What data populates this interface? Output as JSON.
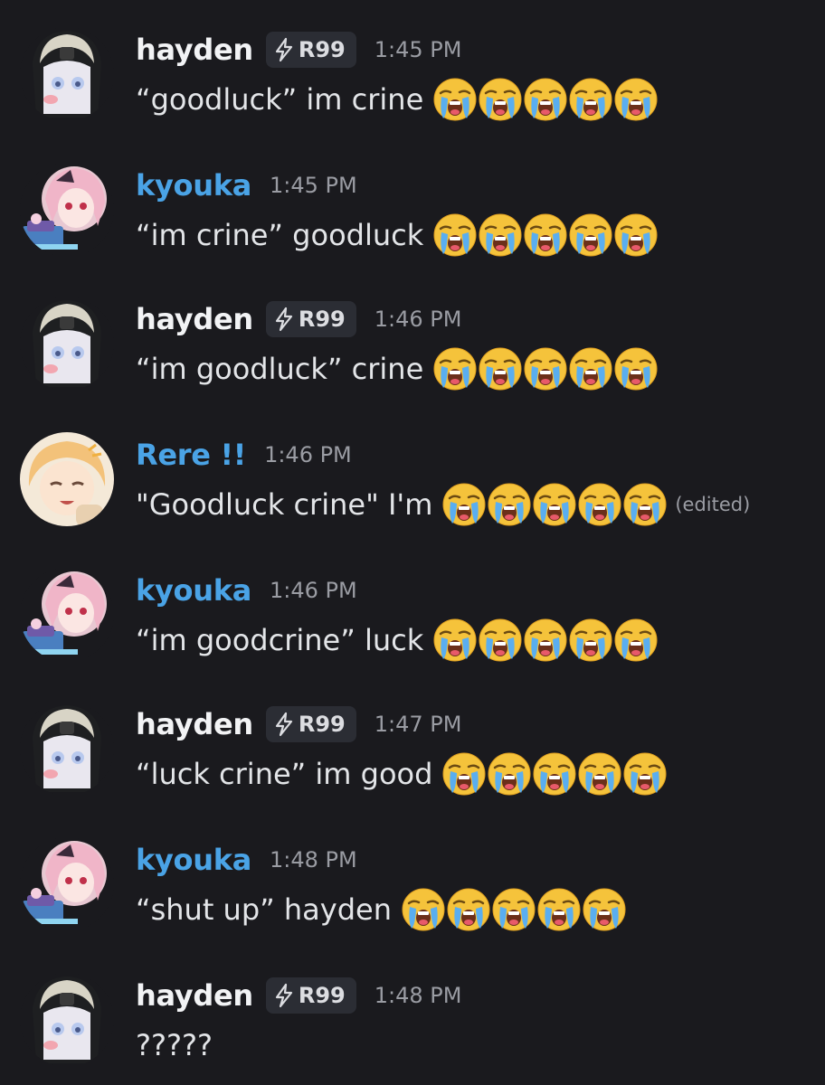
{
  "colors": {
    "background": "#1a1a1e",
    "username_default": "#f2f3f5",
    "username_blue": "#4aa3e6",
    "message_text": "#e3e5e8",
    "timestamp": "#9a9ca3",
    "tag_background": "#2b2d34"
  },
  "messages": [
    {
      "author": "hayden",
      "avatar": "hayden-avatar",
      "tag": "R99",
      "tag_icon": "lightning-bolt-icon",
      "time": "1:45 PM",
      "text": "“goodluck” im crine",
      "emoji": "loudly-crying-face-emoji",
      "emoji_count": 5
    },
    {
      "author": "kyouka",
      "avatar": "kyouka-avatar",
      "time": "1:45 PM",
      "text": "“im crine” goodluck",
      "emoji": "loudly-crying-face-emoji",
      "emoji_count": 5
    },
    {
      "author": "hayden",
      "avatar": "hayden-avatar",
      "tag": "R99",
      "tag_icon": "lightning-bolt-icon",
      "time": "1:46 PM",
      "text": "“im goodluck” crine",
      "emoji": "loudly-crying-face-emoji",
      "emoji_count": 5
    },
    {
      "author": "Rere !!",
      "avatar": "rere-avatar",
      "time": "1:46 PM",
      "text": "\"Goodluck crine\" I'm",
      "emoji": "loudly-crying-face-emoji",
      "emoji_count": 5,
      "edited": "(edited)"
    },
    {
      "author": "kyouka",
      "avatar": "kyouka-avatar",
      "time": "1:46 PM",
      "text": "“im goodcrine” luck",
      "emoji": "loudly-crying-face-emoji",
      "emoji_count": 5
    },
    {
      "author": "hayden",
      "avatar": "hayden-avatar",
      "tag": "R99",
      "tag_icon": "lightning-bolt-icon",
      "time": "1:47 PM",
      "text": "“luck crine” im good",
      "emoji": "loudly-crying-face-emoji",
      "emoji_count": 5
    },
    {
      "author": "kyouka",
      "avatar": "kyouka-avatar",
      "time": "1:48 PM",
      "text": "“shut up” hayden",
      "emoji": "loudly-crying-face-emoji",
      "emoji_count": 5
    },
    {
      "author": "hayden",
      "avatar": "hayden-avatar",
      "tag": "R99",
      "tag_icon": "lightning-bolt-icon",
      "time": "1:48 PM",
      "text": "?????"
    }
  ]
}
